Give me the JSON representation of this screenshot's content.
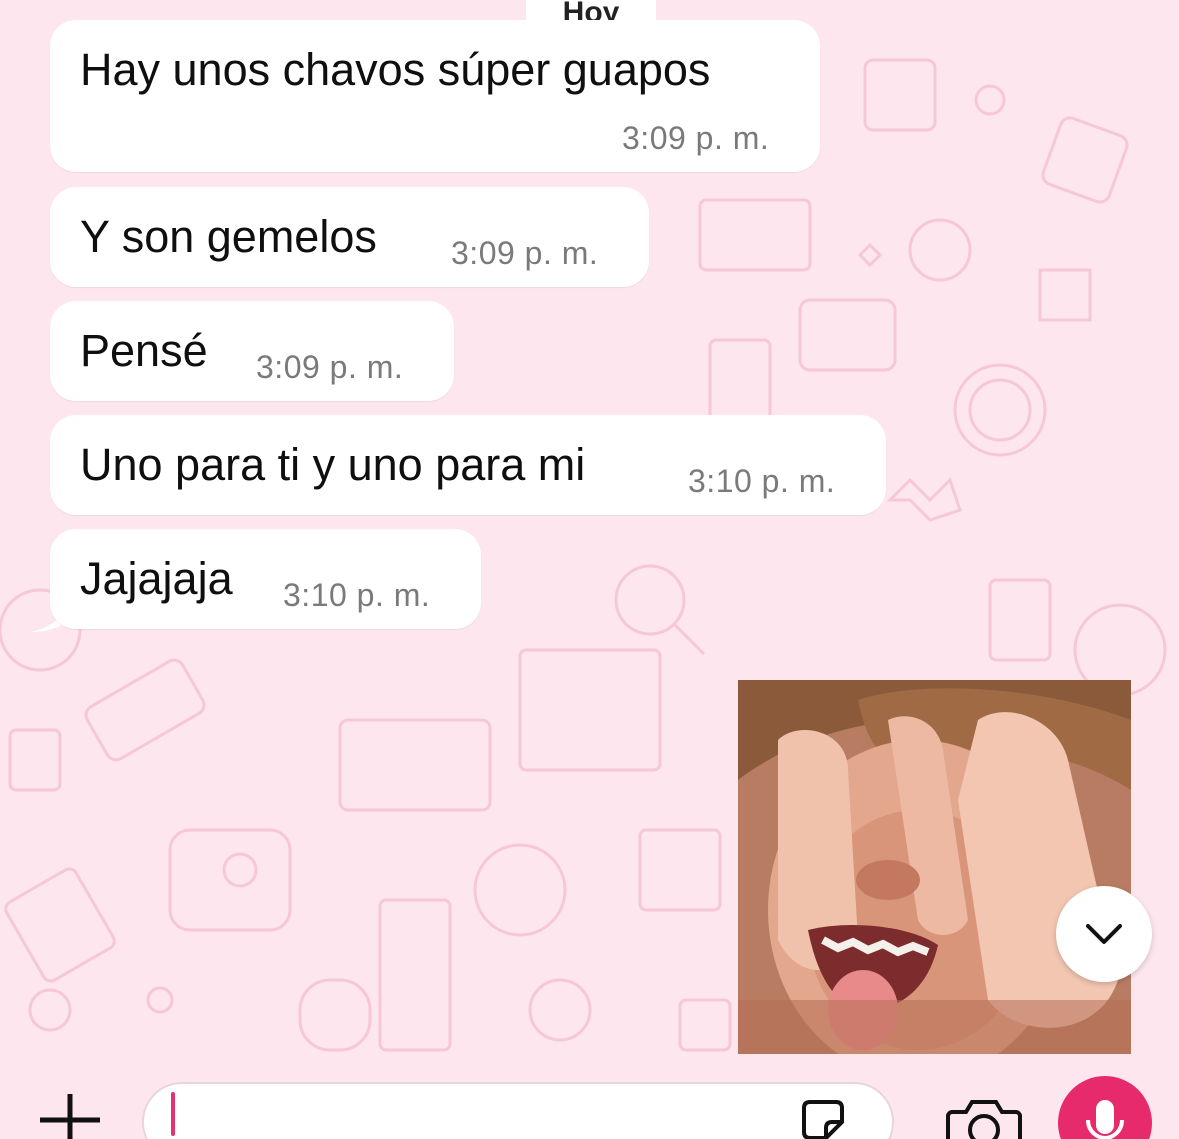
{
  "date_chip": "Hoy",
  "messages": [
    {
      "text": "Hay unos chavos súper guapos",
      "time": "3:09 p. m."
    },
    {
      "text": "Y son gemelos",
      "time": "3:09 p. m."
    },
    {
      "text": "Pensé",
      "time": "3:09 p. m."
    },
    {
      "text": "Uno para ti y uno para mi",
      "time": "3:10 p. m."
    },
    {
      "text": "Jajajaja",
      "time": "3:10 p. m."
    }
  ],
  "colors": {
    "chat_background": "#fde6ee",
    "bubble": "#ffffff",
    "accent": "#e72a6c",
    "timestamp": "#7a7a7a"
  },
  "icons": {
    "add": "plus-icon",
    "sticker": "sticker-icon",
    "camera": "camera-icon",
    "mic": "microphone-icon",
    "scroll": "chevron-down-icon"
  }
}
